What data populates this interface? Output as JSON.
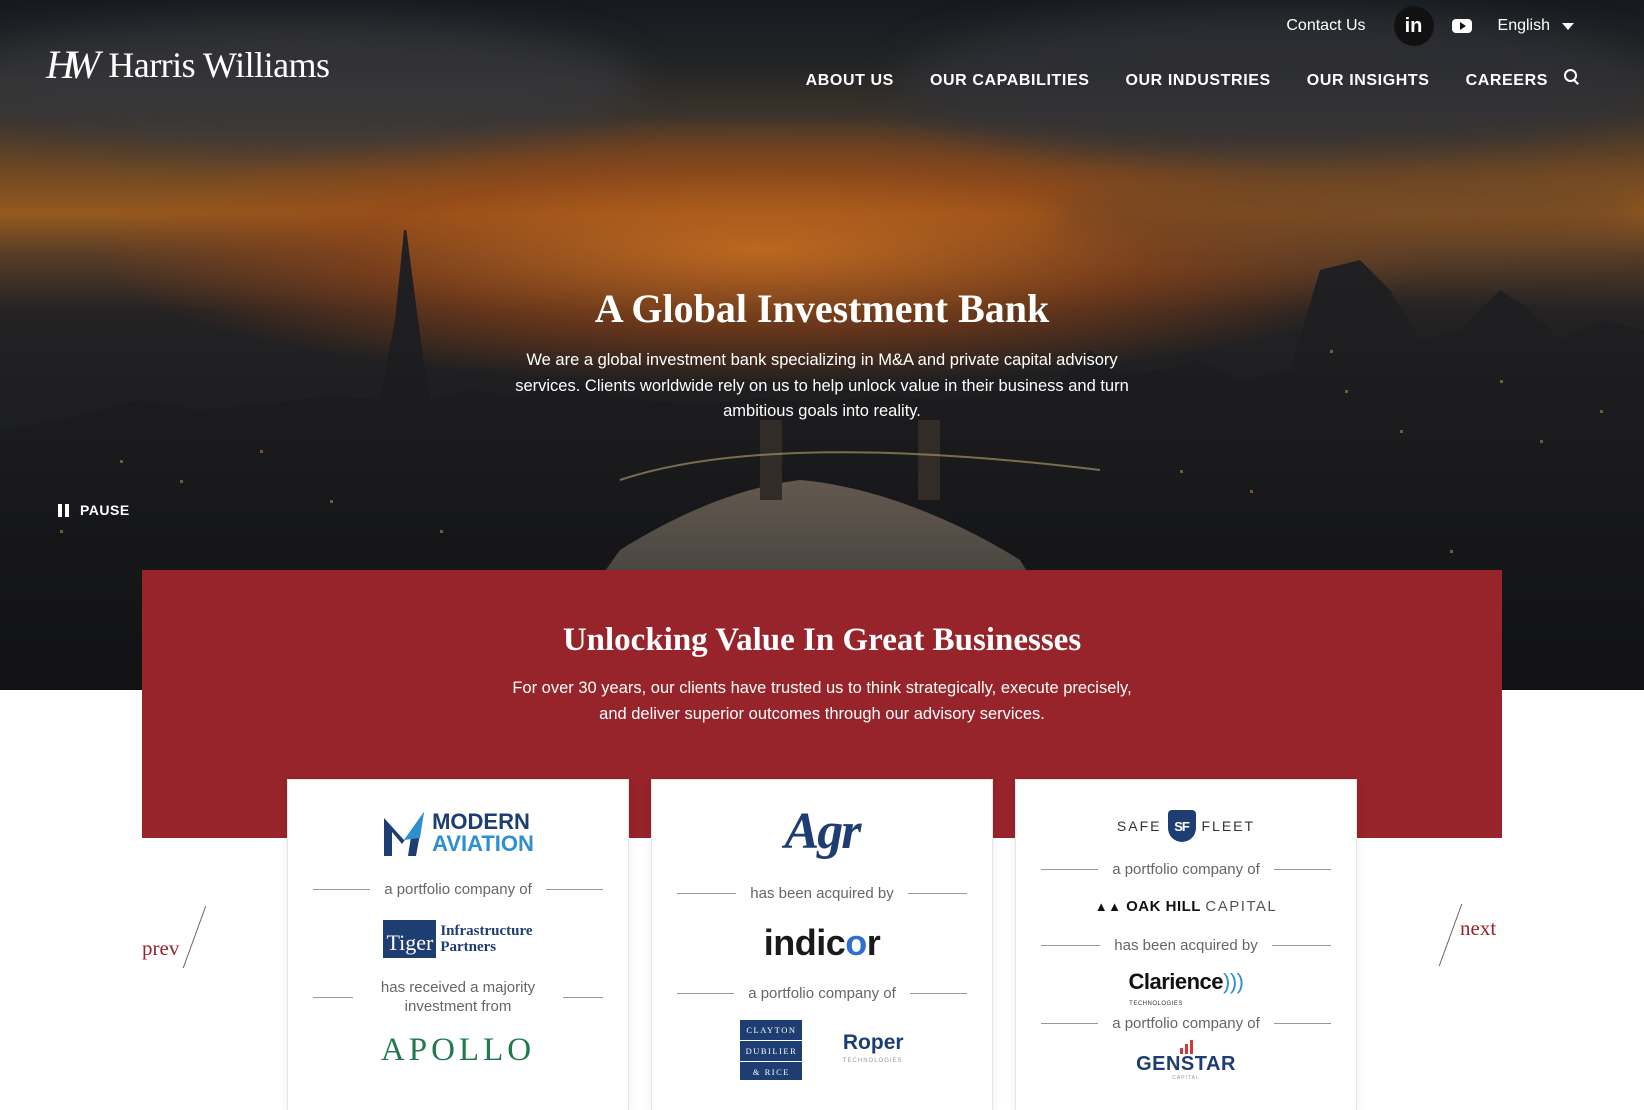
{
  "header": {
    "logo_mark": "HW",
    "logo_text": "Harris Williams",
    "contact": "Contact Us",
    "social_linkedin": "in",
    "language": "English",
    "nav": [
      "ABOUT US",
      "OUR CAPABILITIES",
      "OUR INDUSTRIES",
      "OUR INSIGHTS",
      "CAREERS"
    ]
  },
  "hero": {
    "title": "A Global Investment Bank",
    "subtitle": "We are a global investment bank specializing in M&A and private capital advisory services. Clients worldwide rely on us to help unlock value in their business and turn ambitious goals into reality.",
    "pause_label": "PAUSE"
  },
  "intro": {
    "title": "Unlocking Value In Great Businesses",
    "subtitle": "For over 30 years, our clients have trusted us to think strategically, execute precisely, and deliver superior outcomes through our advisory services."
  },
  "carousel": {
    "prev": "prev",
    "next": "next",
    "cards": [
      {
        "logo1_line1": "MODERN",
        "logo1_line2": "AVIATION",
        "sep1": "a portfolio company of",
        "logo2_box": "Tiger",
        "logo2_line1": "Infrastructure",
        "logo2_line2": "Partners",
        "sep2_line1": "has received a majority",
        "sep2_line2": "investment from",
        "logo3": "APOLLO"
      },
      {
        "logo1": "Agr",
        "sep1": "has been acquired by",
        "logo2_a": "indic",
        "logo2_o": "o",
        "logo2_b": "r",
        "sep2": "a portfolio company of",
        "logo3_l1": "CLAYTON",
        "logo3_l2": "DUBILIER",
        "logo3_l3": "& RICE",
        "logo4": "Roper",
        "logo4_sub": "TECHNOLOGIES"
      },
      {
        "logo1_left": "SAFE",
        "logo1_shield": "SF",
        "logo1_right": "FLEET",
        "sep1": "a portfolio company of",
        "logo2_a": "OAK HILL",
        "logo2_b": "CAPITAL",
        "sep2": "has been acquired by",
        "logo3": "Clarience",
        "logo3_sub": "TECHNOLOGIES",
        "sep3": "a portfolio company of",
        "logo4": "GENSTAR",
        "logo4_sub": "CAPITAL"
      }
    ]
  },
  "colors": {
    "brand_red": "#97232b",
    "navy": "#1e3d72",
    "apollo_green": "#1f7a4d"
  }
}
